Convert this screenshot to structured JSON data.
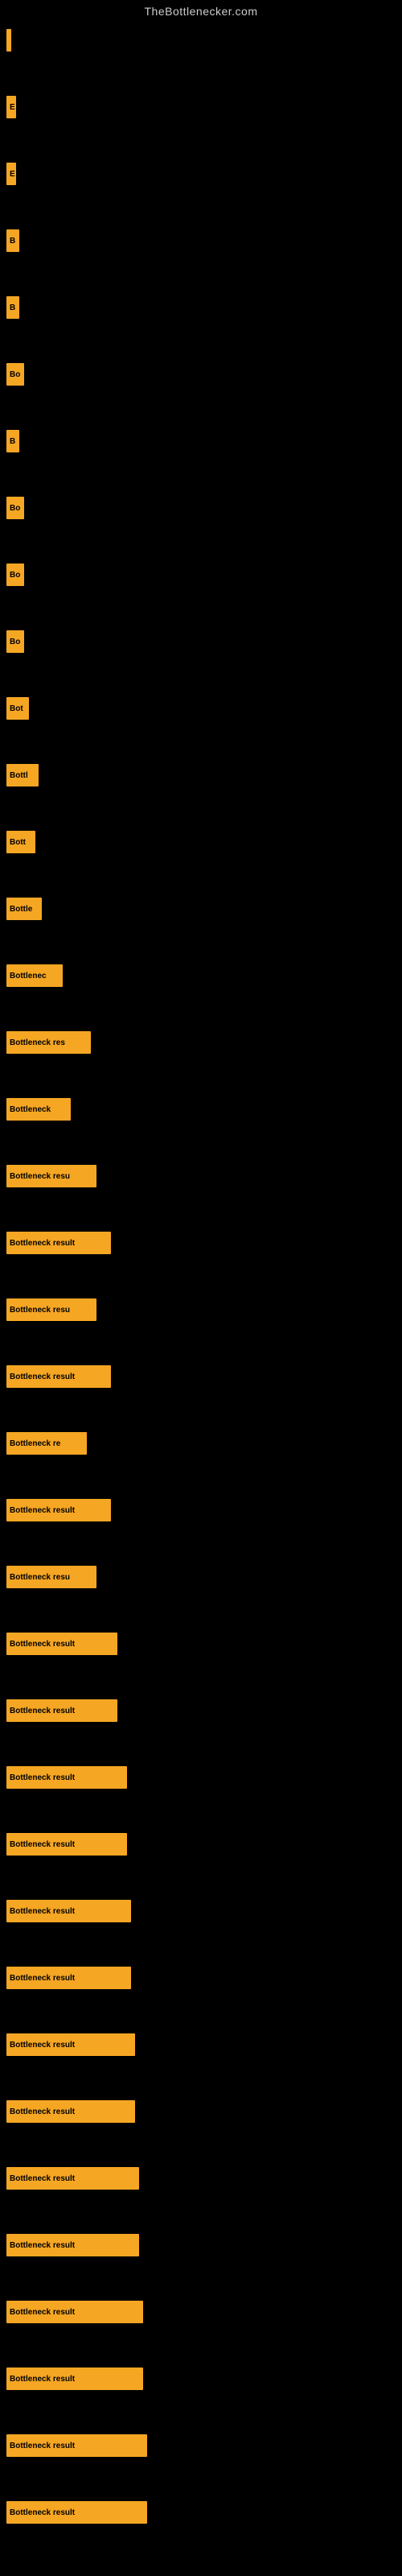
{
  "site": {
    "title": "TheBottlenecker.com"
  },
  "bars": [
    {
      "id": 1,
      "label": "",
      "width": 6,
      "spacer": 55
    },
    {
      "id": 2,
      "label": "E",
      "width": 12,
      "spacer": 55
    },
    {
      "id": 3,
      "label": "E",
      "width": 12,
      "spacer": 55
    },
    {
      "id": 4,
      "label": "B",
      "width": 16,
      "spacer": 55
    },
    {
      "id": 5,
      "label": "B",
      "width": 16,
      "spacer": 55
    },
    {
      "id": 6,
      "label": "Bo",
      "width": 22,
      "spacer": 55
    },
    {
      "id": 7,
      "label": "B",
      "width": 16,
      "spacer": 55
    },
    {
      "id": 8,
      "label": "Bo",
      "width": 22,
      "spacer": 55
    },
    {
      "id": 9,
      "label": "Bo",
      "width": 22,
      "spacer": 55
    },
    {
      "id": 10,
      "label": "Bo",
      "width": 22,
      "spacer": 55
    },
    {
      "id": 11,
      "label": "Bot",
      "width": 28,
      "spacer": 55
    },
    {
      "id": 12,
      "label": "Bottl",
      "width": 40,
      "spacer": 55
    },
    {
      "id": 13,
      "label": "Bott",
      "width": 36,
      "spacer": 55
    },
    {
      "id": 14,
      "label": "Bottle",
      "width": 44,
      "spacer": 55
    },
    {
      "id": 15,
      "label": "Bottlenec",
      "width": 70,
      "spacer": 55
    },
    {
      "id": 16,
      "label": "Bottleneck res",
      "width": 105,
      "spacer": 55
    },
    {
      "id": 17,
      "label": "Bottleneck",
      "width": 80,
      "spacer": 55
    },
    {
      "id": 18,
      "label": "Bottleneck resu",
      "width": 112,
      "spacer": 55
    },
    {
      "id": 19,
      "label": "Bottleneck result",
      "width": 130,
      "spacer": 55
    },
    {
      "id": 20,
      "label": "Bottleneck resu",
      "width": 112,
      "spacer": 55
    },
    {
      "id": 21,
      "label": "Bottleneck result",
      "width": 130,
      "spacer": 55
    },
    {
      "id": 22,
      "label": "Bottleneck re",
      "width": 100,
      "spacer": 55
    },
    {
      "id": 23,
      "label": "Bottleneck result",
      "width": 130,
      "spacer": 55
    },
    {
      "id": 24,
      "label": "Bottleneck resu",
      "width": 112,
      "spacer": 55
    },
    {
      "id": 25,
      "label": "Bottleneck result",
      "width": 138,
      "spacer": 55
    },
    {
      "id": 26,
      "label": "Bottleneck result",
      "width": 138,
      "spacer": 55
    },
    {
      "id": 27,
      "label": "Bottleneck result",
      "width": 150,
      "spacer": 55
    },
    {
      "id": 28,
      "label": "Bottleneck result",
      "width": 150,
      "spacer": 55
    },
    {
      "id": 29,
      "label": "Bottleneck result",
      "width": 155,
      "spacer": 55
    },
    {
      "id": 30,
      "label": "Bottleneck result",
      "width": 155,
      "spacer": 55
    },
    {
      "id": 31,
      "label": "Bottleneck result",
      "width": 160,
      "spacer": 55
    },
    {
      "id": 32,
      "label": "Bottleneck result",
      "width": 160,
      "spacer": 55
    },
    {
      "id": 33,
      "label": "Bottleneck result",
      "width": 165,
      "spacer": 55
    },
    {
      "id": 34,
      "label": "Bottleneck result",
      "width": 165,
      "spacer": 55
    },
    {
      "id": 35,
      "label": "Bottleneck result",
      "width": 170,
      "spacer": 55
    },
    {
      "id": 36,
      "label": "Bottleneck result",
      "width": 170,
      "spacer": 55
    },
    {
      "id": 37,
      "label": "Bottleneck result",
      "width": 175,
      "spacer": 55
    },
    {
      "id": 38,
      "label": "Bottleneck result",
      "width": 175,
      "spacer": 40
    }
  ]
}
